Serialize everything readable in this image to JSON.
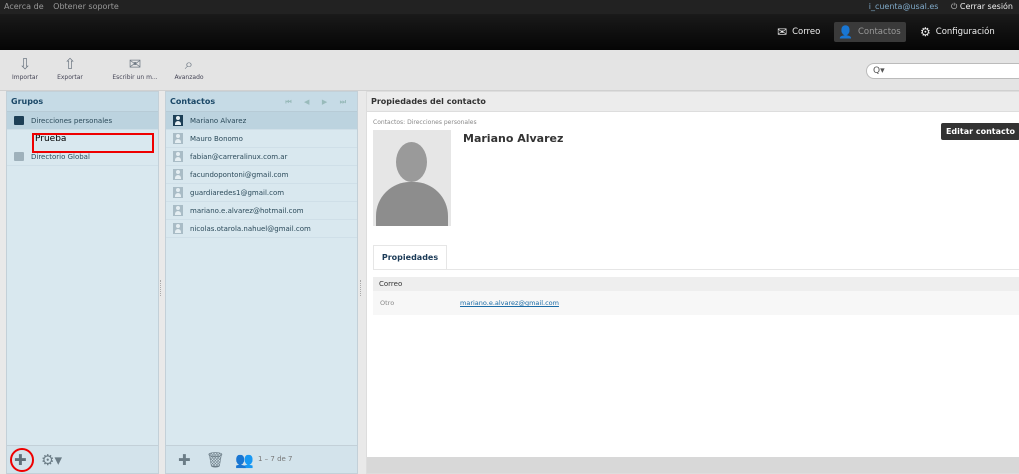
{
  "topbar": {
    "about": "Acerca de",
    "support": "Obtener soporte",
    "user": "i_cuenta@usal.es",
    "logout": "Cerrar sesión"
  },
  "nav": {
    "mail": "Correo",
    "contacts": "Contactos",
    "settings": "Configuración"
  },
  "toolbar": {
    "import": "Importar",
    "export": "Exportar",
    "compose": "Escribir un m...",
    "advanced": "Avanzado",
    "search_icon": "Q▾"
  },
  "groups": {
    "title": "Grupos",
    "items": [
      "Direcciones personales",
      "Directorio Global"
    ],
    "subgroup": "Prueba"
  },
  "contacts": {
    "title": "Contactos",
    "pager": "⏮ ◀ ▶ ⏭",
    "items": [
      "Mariano Alvarez",
      "Mauro Bonomo",
      "fabian@carreralinux.com.ar",
      "facundopontoni@gmail.com",
      "guardiaredes1@gmail.com",
      "mariano.e.alvarez@hotmail.com",
      "nicolas.otarola.nahuel@gmail.com"
    ],
    "count": "1 – 7 de 7"
  },
  "details": {
    "title": "Propiedades del contacto",
    "breadcrumb": "Contactos: Direcciones personales",
    "name": "Mariano Alvarez",
    "edit": "Editar contacto",
    "tab": "Propiedades",
    "section": "Correo",
    "field_label": "Otro",
    "field_value": "mariano.e.alvarez@gmail.com"
  },
  "colors": {
    "accent": "#f07a1a",
    "highlight": "#ee0000"
  }
}
